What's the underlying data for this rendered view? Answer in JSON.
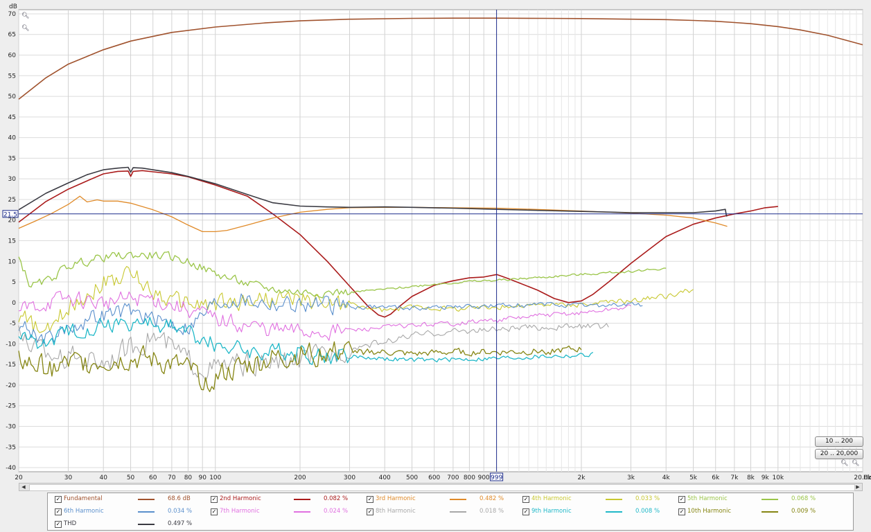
{
  "chart_data": {
    "type": "line",
    "ylabel": "dB",
    "xunit": "Hz",
    "xscale": "log",
    "xlim": [
      20,
      20000
    ],
    "ylim": [
      -41,
      71
    ],
    "grid": true,
    "y_ticks": [
      70,
      65,
      60,
      55,
      50,
      45,
      40,
      35,
      30,
      25,
      20,
      15,
      10,
      5,
      0,
      -5,
      -10,
      -15,
      -20,
      -25,
      -30,
      -35,
      -40
    ],
    "x_ticks": [
      {
        "v": 20,
        "label": "20"
      },
      {
        "v": 30,
        "label": "30"
      },
      {
        "v": 40,
        "label": "40"
      },
      {
        "v": 50,
        "label": "50"
      },
      {
        "v": 60,
        "label": "60"
      },
      {
        "v": 70,
        "label": "70"
      },
      {
        "v": 80,
        "label": "80"
      },
      {
        "v": 90,
        "label": "90"
      },
      {
        "v": 100,
        "label": "100"
      },
      {
        "v": 200,
        "label": "200"
      },
      {
        "v": 300,
        "label": "300"
      },
      {
        "v": 400,
        "label": "400"
      },
      {
        "v": 500,
        "label": "500"
      },
      {
        "v": 600,
        "label": "600"
      },
      {
        "v": 700,
        "label": "700"
      },
      {
        "v": 800,
        "label": "800"
      },
      {
        "v": 900,
        "label": "900"
      },
      {
        "v": 2000,
        "label": "2k"
      },
      {
        "v": 3000,
        "label": "3k"
      },
      {
        "v": 4000,
        "label": "4k"
      },
      {
        "v": 5000,
        "label": "5k"
      },
      {
        "v": 6000,
        "label": "6k"
      },
      {
        "v": 7000,
        "label": "7k"
      },
      {
        "v": 8000,
        "label": "8k"
      },
      {
        "v": 9000,
        "label": "9k"
      },
      {
        "v": 10000,
        "label": "10k"
      },
      {
        "v": 20000,
        "label": "20.0k"
      }
    ],
    "minor_x": [
      1100,
      1200,
      1300,
      1400,
      1500,
      1600,
      1700,
      1800,
      1900,
      11000,
      12000,
      13000,
      14000,
      15000,
      16000,
      17000,
      18000,
      19000
    ],
    "cursor": {
      "x": 999,
      "x_label": "999",
      "y": 21.5,
      "y_label": "21.5"
    },
    "series": [
      {
        "name": "Fundamental",
        "color": "#a0522d",
        "width": 1.6,
        "x": [
          20,
          25,
          30,
          40,
          50,
          70,
          100,
          150,
          200,
          300,
          500,
          700,
          1000,
          1500,
          2000,
          3000,
          4000,
          5000,
          6000,
          7000,
          8000,
          10000,
          12000,
          15000,
          20000
        ],
        "y": [
          49.3,
          54.5,
          57.8,
          61.3,
          63.4,
          65.5,
          66.8,
          67.8,
          68.3,
          68.7,
          68.9,
          68.95,
          68.95,
          68.9,
          68.85,
          68.7,
          68.6,
          68.4,
          68.2,
          67.9,
          67.6,
          66.9,
          66.1,
          64.8,
          62.5
        ]
      },
      {
        "name": "2nd Harmonic",
        "color": "#aa1a1a",
        "width": 1.6,
        "x": [
          20,
          25,
          30,
          35,
          40,
          45,
          49,
          50,
          51,
          55,
          60,
          70,
          80,
          100,
          130,
          160,
          200,
          250,
          300,
          350,
          380,
          400,
          420,
          450,
          500,
          600,
          700,
          800,
          900,
          1000,
          1050,
          1100,
          1200,
          1400,
          1600,
          1800,
          2000,
          2200,
          2500,
          3000,
          3500,
          4000,
          5000,
          6000,
          7000,
          8000,
          9000,
          10000
        ],
        "y": [
          19.5,
          24.5,
          27.5,
          29.5,
          31.2,
          31.8,
          31.9,
          30.6,
          31.8,
          32,
          31.7,
          31.2,
          30.5,
          28.5,
          25.8,
          21.5,
          16.5,
          10,
          4,
          -1,
          -3,
          -3.5,
          -2.8,
          -1,
          1.5,
          4.2,
          5.3,
          6,
          6.2,
          6.8,
          6.3,
          5.8,
          4.8,
          3,
          1,
          0,
          0.4,
          2,
          5,
          9.5,
          13,
          16,
          19,
          20.5,
          21.5,
          22.2,
          23,
          23.3
        ]
      },
      {
        "name": "3rd Harmonic",
        "color": "#e08a28",
        "width": 1.3,
        "x": [
          20,
          23,
          26,
          30,
          33,
          35,
          38,
          40,
          45,
          50,
          60,
          70,
          80,
          90,
          100,
          110,
          130,
          160,
          200,
          250,
          300,
          400,
          500,
          700,
          1000,
          1500,
          2000,
          3000,
          4000,
          5000,
          6000,
          6600
        ],
        "y": [
          18,
          19.8,
          21.5,
          23.8,
          25.8,
          24.4,
          24.9,
          24.6,
          24.6,
          24.1,
          22.5,
          20.8,
          18.8,
          17.2,
          17.2,
          17.5,
          18.8,
          20.5,
          21.9,
          22.6,
          23,
          23.1,
          23.1,
          23,
          22.9,
          22.5,
          22.2,
          21.7,
          21.2,
          20.5,
          19.3,
          18.5
        ]
      },
      {
        "name": "4th Harmonic",
        "color": "#c8c830",
        "width": 1.1,
        "noise": 1.3,
        "x": [
          20,
          25,
          30,
          40,
          50,
          60,
          70,
          90,
          120,
          150,
          200,
          300,
          400,
          500,
          700,
          1000,
          1500,
          2000,
          3000,
          4000,
          5000
        ],
        "y": [
          -3,
          -8,
          -1,
          5,
          7,
          3,
          0.5,
          -0.5,
          0,
          1,
          0.5,
          -0.5,
          -2,
          -1,
          -1.5,
          -1,
          -0.5,
          -0.5,
          0.5,
          1.5,
          3.2
        ]
      },
      {
        "name": "5th Harmonic",
        "color": "#9ac548",
        "width": 1.3,
        "noise": 0.6,
        "x": [
          20,
          22,
          25,
          30,
          40,
          50,
          60,
          70,
          80,
          100,
          130,
          160,
          200,
          300,
          400,
          600,
          800,
          1000,
          1500,
          2000,
          3000,
          4000
        ],
        "y": [
          11,
          4,
          5,
          9,
          11,
          11.5,
          11.5,
          11,
          10,
          7,
          4.5,
          3.2,
          2.5,
          2.5,
          3.2,
          4.5,
          5.1,
          5.4,
          6.2,
          6.8,
          7.6,
          8.3
        ]
      },
      {
        "name": "6th Harmonic",
        "color": "#5a8fcc",
        "width": 1.1,
        "noise": 1.2,
        "x": [
          20,
          25,
          30,
          40,
          50,
          60,
          70,
          80,
          90,
          100,
          120,
          150,
          200,
          300,
          400,
          500,
          700,
          1000,
          1500,
          2000,
          3000,
          3300
        ],
        "y": [
          -5,
          -9,
          -6,
          -3,
          -2,
          -4,
          -5,
          -6,
          -3,
          0,
          1,
          0,
          -0.5,
          -1,
          -1,
          -1.3,
          -1,
          -0.8,
          -0.5,
          -0.8,
          -0.5,
          -0.4
        ]
      },
      {
        "name": "7th Harmonic",
        "color": "#e070e0",
        "width": 1.1,
        "noise": 1.2,
        "x": [
          20,
          25,
          30,
          40,
          50,
          60,
          70,
          80,
          100,
          130,
          160,
          200,
          300,
          400,
          500,
          700,
          1000,
          1500,
          2000,
          3000
        ],
        "y": [
          -2,
          0,
          1,
          0,
          1,
          1,
          -0.5,
          -1.5,
          -4,
          -5.5,
          -6.5,
          -7,
          -6.8,
          -6,
          -5.5,
          -5,
          -4.2,
          -3,
          -2.5,
          -1
        ]
      },
      {
        "name": "8th Harmonic",
        "color": "#a8a8a8",
        "width": 1.1,
        "noise": 1.6,
        "x": [
          20,
          25,
          30,
          40,
          50,
          60,
          70,
          80,
          90,
          100,
          120,
          150,
          200,
          250,
          300,
          400,
          500,
          700,
          1000,
          1500,
          2000,
          2500
        ],
        "y": [
          -8,
          -12,
          -13,
          -14,
          -11,
          -8,
          -11,
          -14,
          -16,
          -16,
          -15,
          -15,
          -14,
          -13,
          -11,
          -9.5,
          -8,
          -7,
          -6.5,
          -6,
          -5.8,
          -5.8
        ]
      },
      {
        "name": "9th Harmonic",
        "color": "#20b8c8",
        "width": 1.3,
        "noise": 1.2,
        "x": [
          20,
          25,
          30,
          40,
          50,
          60,
          70,
          80,
          90,
          100,
          120,
          150,
          200,
          250,
          300,
          400,
          500,
          700,
          1000,
          1500,
          2000,
          2200
        ],
        "y": [
          -8,
          -10,
          -7,
          -5,
          -5,
          -5,
          -6,
          -7,
          -9,
          -10,
          -11,
          -12,
          -12,
          -13,
          -13,
          -13.5,
          -14,
          -13.8,
          -13.5,
          -13,
          -12.8,
          -12.5
        ]
      },
      {
        "name": "10th Harmonic",
        "color": "#858512",
        "width": 1.3,
        "noise": 1.7,
        "x": [
          20,
          25,
          30,
          40,
          50,
          60,
          70,
          80,
          90,
          100,
          120,
          150,
          200,
          250,
          300,
          400,
          500,
          700,
          1000,
          1500,
          2000
        ],
        "y": [
          -14,
          -16,
          -15,
          -14,
          -13.5,
          -14,
          -15,
          -16.5,
          -18,
          -18,
          -16,
          -14,
          -12.5,
          -12,
          -12,
          -12,
          -12.5,
          -12,
          -12,
          -11.8,
          -11.2
        ]
      },
      {
        "name": "THD",
        "color": "#3a3a42",
        "width": 1.6,
        "x": [
          20,
          25,
          30,
          35,
          40,
          45,
          49,
          50,
          51,
          55,
          60,
          70,
          80,
          100,
          130,
          160,
          200,
          250,
          300,
          400,
          500,
          700,
          1000,
          1500,
          2000,
          3000,
          4000,
          5000,
          6000,
          6500,
          6560,
          6600
        ],
        "y": [
          22.5,
          26.5,
          29,
          31,
          32.2,
          32.6,
          32.8,
          31.6,
          32.7,
          32.6,
          32.2,
          31.5,
          30.6,
          28.8,
          26.2,
          24.2,
          23.4,
          23.2,
          23.1,
          23.2,
          23.1,
          22.9,
          22.6,
          22.3,
          22.1,
          21.8,
          21.8,
          21.8,
          22.2,
          22.6,
          21,
          21
        ]
      }
    ]
  },
  "legend": [
    {
      "label": "Fundamental",
      "value": "68.6 dB",
      "color": "#a0522d"
    },
    {
      "label": "2nd Harmonic",
      "value": "0.082 %",
      "color": "#aa1a1a"
    },
    {
      "label": "3rd Harmonic",
      "value": "0.482 %",
      "color": "#e08a28"
    },
    {
      "label": "4th Harmonic",
      "value": "0.033 %",
      "color": "#c8c830"
    },
    {
      "label": "5th Harmonic",
      "value": "0.068 %",
      "color": "#9ac548"
    },
    {
      "label": "6th Harmonic",
      "value": "0.034 %",
      "color": "#5a8fcc"
    },
    {
      "label": "7th Harmonic",
      "value": "0.024 %",
      "color": "#e070e0"
    },
    {
      "label": "8th Harmonic",
      "value": "0.018 %",
      "color": "#a8a8a8"
    },
    {
      "label": "9th Harmonic",
      "value": "0.008 %",
      "color": "#20b8c8"
    },
    {
      "label": "10th Harmonic",
      "value": "0.009 %",
      "color": "#858512"
    },
    {
      "label": "THD",
      "value": "0.497 %",
      "color": "#3a3a42"
    }
  ],
  "range_buttons": {
    "low": "10 .. 200",
    "full": "20 .. 20,000"
  },
  "checkbox_mark": "✓",
  "icons": {
    "zoom_in": "zoom-in-icon",
    "zoom_out": "zoom-out-icon",
    "scroll_left": "left-arrow-icon",
    "scroll_right": "right-arrow-icon"
  }
}
